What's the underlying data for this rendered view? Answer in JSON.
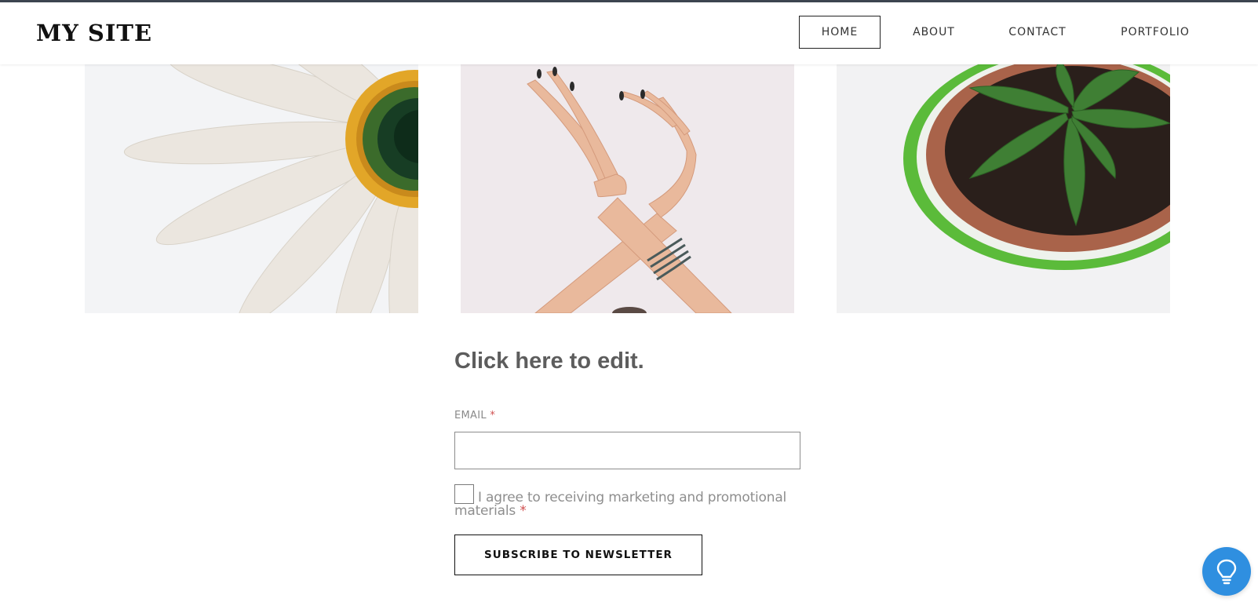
{
  "site": {
    "title": "MY SITE"
  },
  "nav": {
    "items": [
      {
        "label": "HOME",
        "active": true
      },
      {
        "label": "ABOUT",
        "active": false
      },
      {
        "label": "CONTACT",
        "active": false
      },
      {
        "label": "PORTFOLIO",
        "active": false
      }
    ]
  },
  "gallery": {
    "images": [
      {
        "icon": "daisy-flower-image"
      },
      {
        "icon": "crossed-hands-image"
      },
      {
        "icon": "potted-plant-image"
      }
    ]
  },
  "form": {
    "title": "Click here to edit.",
    "email_label": "EMAIL",
    "required_mark": "*",
    "email_value": "",
    "email_placeholder": "",
    "consent_text": "I agree to receiving marketing and promotional materials",
    "subscribe_label": "SUBSCRIBE TO NEWSLETTER"
  },
  "help": {
    "icon": "lightbulb-icon"
  },
  "colors": {
    "accent": "#2f8fe0",
    "required": "#d05050",
    "top_border": "#3d4550"
  }
}
